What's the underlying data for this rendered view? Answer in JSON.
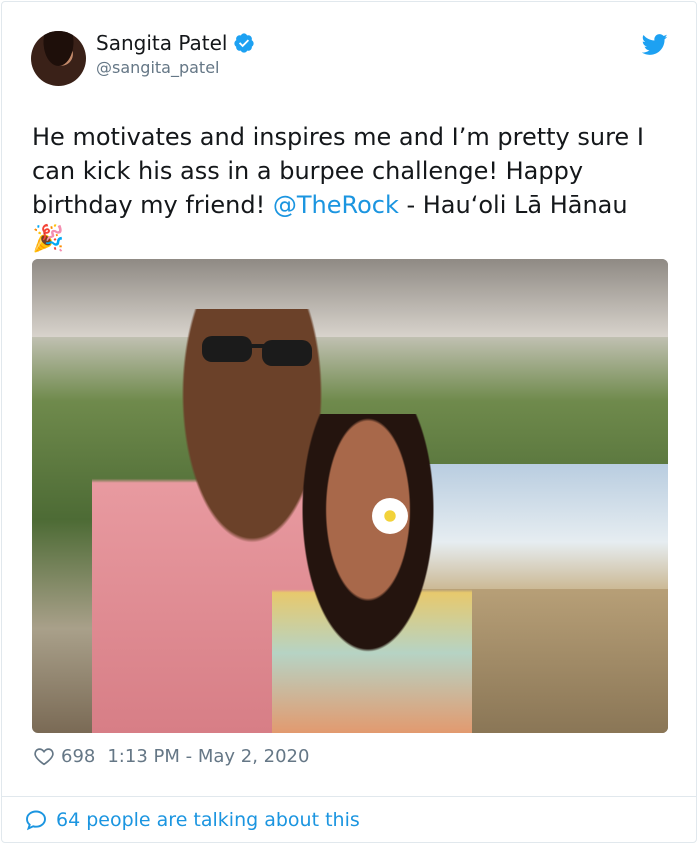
{
  "author": {
    "name": "Sangita Patel",
    "handle": "@sangita_patel",
    "verified": true
  },
  "tweet": {
    "text_before": "He motivates and inspires me and I’m pretty sure I can kick his ass in a burpee challenge! Happy birthday my friend! ",
    "mention": "@TheRock",
    "text_after": "  - Hau‘oli Lā Hānau",
    "emoji": "🎉"
  },
  "meta": {
    "likes": "698",
    "timestamp": "1:13 PM - May 2, 2020"
  },
  "footer": {
    "talking": "64 people are talking about this"
  },
  "colors": {
    "link": "#1b95e0",
    "muted": "#657786",
    "text": "#14171a",
    "border": "#e1e8ed"
  },
  "icons": {
    "brand": "twitter-bird-icon",
    "verified": "verified-badge-icon",
    "like": "heart-icon",
    "reply": "speech-bubble-icon"
  }
}
